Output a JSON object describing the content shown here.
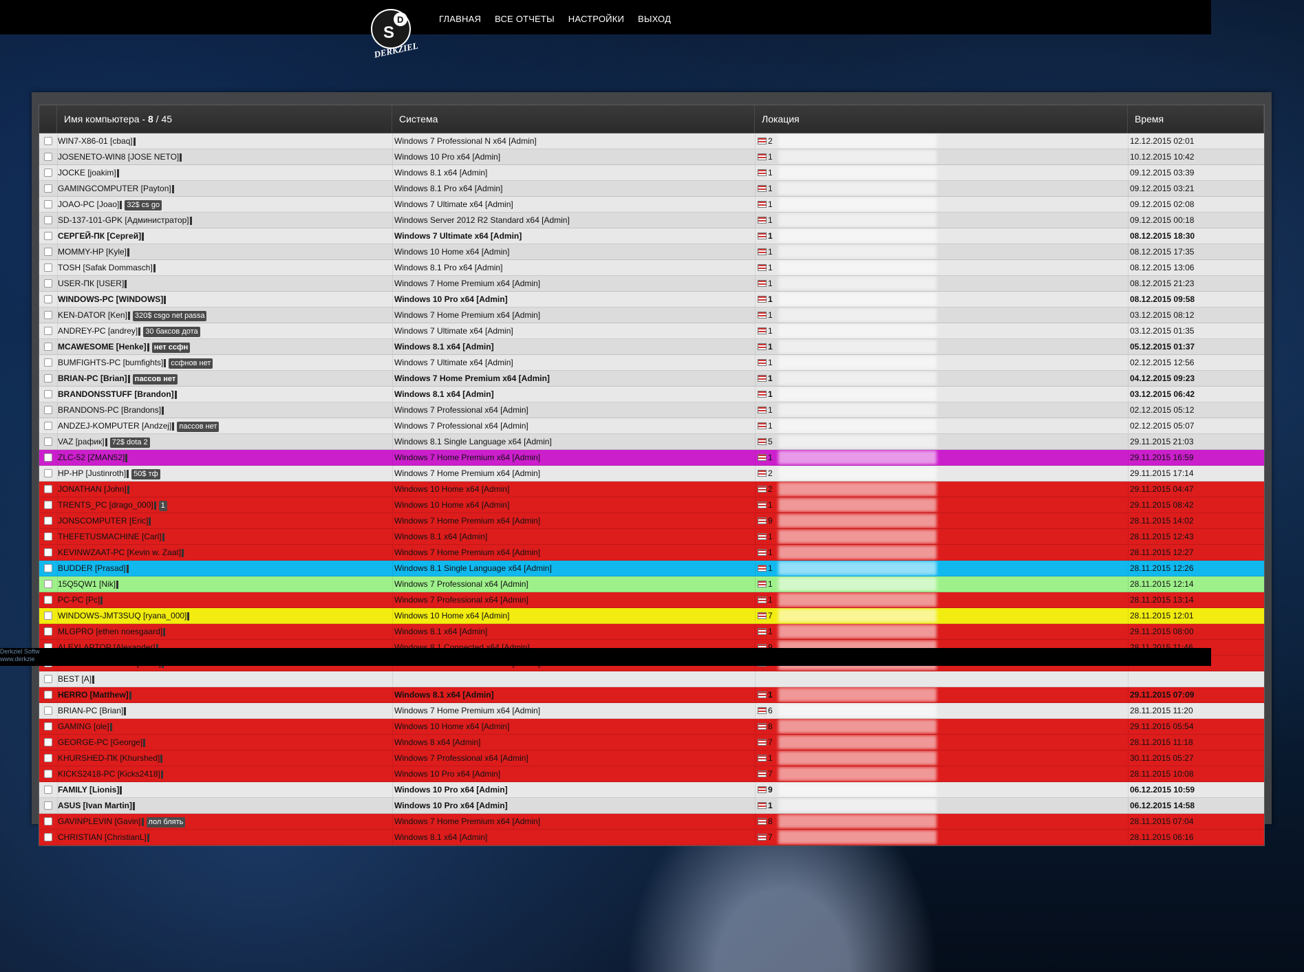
{
  "nav": {
    "items": [
      "ГЛАВНАЯ",
      "ВСЕ ОТЧЕТЫ",
      "НАСТРОЙКИ",
      "ВЫХОД"
    ]
  },
  "logo": {
    "text": "DERKZIEL SOFTWARE"
  },
  "footer": {
    "line1": "Derkziel Softw",
    "line2": "www.derkzie"
  },
  "table": {
    "headers": {
      "computer": "Имя компьютера - ",
      "count_current": "8",
      "count_total": " / 45",
      "system": "Система",
      "location": "Локация",
      "time": "Время"
    },
    "rows": [
      {
        "name": "WIN7-X86-01 [cbaq]",
        "tag": "",
        "system": "Windows 7 Professional N x64 [Admin]",
        "loc": "2",
        "time": "12.12.2015 02:01",
        "bg": "#e8e8e8",
        "bold": false
      },
      {
        "name": "JOSENETO-WIN8 [JOSE NETO]",
        "tag": "",
        "system": "Windows 10 Pro x64 [Admin]",
        "loc": "1",
        "time": "10.12.2015 10:42",
        "bg": "#dcdcdc",
        "bold": false
      },
      {
        "name": "JOCKE [joakim]",
        "tag": "",
        "system": "Windows 8.1 x64 [Admin]",
        "loc": "1",
        "time": "09.12.2015 03:39",
        "bg": "#e8e8e8",
        "bold": false
      },
      {
        "name": "GAMINGCOMPUTER [Payton]",
        "tag": "",
        "system": "Windows 8.1 Pro x64 [Admin]",
        "loc": "1",
        "time": "09.12.2015 03:21",
        "bg": "#dcdcdc",
        "bold": false
      },
      {
        "name": "JOAO-PC [Joao]",
        "tag": "32$ cs go",
        "system": "Windows 7 Ultimate x64 [Admin]",
        "loc": "1",
        "time": "09.12.2015 02:08",
        "bg": "#e8e8e8",
        "bold": false
      },
      {
        "name": "SD-137-101-GPK [Администратор]",
        "tag": "",
        "system": "Windows Server 2012 R2 Standard x64 [Admin]",
        "loc": "1",
        "time": "09.12.2015 00:18",
        "bg": "#dcdcdc",
        "bold": false
      },
      {
        "name": "СЕРГЕЙ-ПК [Сергей]",
        "tag": "",
        "system": "Windows 7 Ultimate x64 [Admin]",
        "loc": "1",
        "time": "08.12.2015 18:30",
        "bg": "#e8e8e8",
        "bold": true
      },
      {
        "name": "MOMMY-HP [Kyle]",
        "tag": "",
        "system": "Windows 10 Home x64 [Admin]",
        "loc": "1",
        "time": "08.12.2015 17:35",
        "bg": "#dcdcdc",
        "bold": false
      },
      {
        "name": "TOSH [Safak Dommasch]",
        "tag": "",
        "system": "Windows 8.1 Pro x64 [Admin]",
        "loc": "1",
        "time": "08.12.2015 13:06",
        "bg": "#e8e8e8",
        "bold": false
      },
      {
        "name": "USER-ПК [USER]",
        "tag": "",
        "system": "Windows 7 Home Premium x64 [Admin]",
        "loc": "1",
        "time": "08.12.2015 21:23",
        "bg": "#dcdcdc",
        "bold": false
      },
      {
        "name": "WINDOWS-PC [WINDOWS]",
        "tag": "",
        "system": "Windows 10 Pro x64 [Admin]",
        "loc": "1",
        "time": "08.12.2015 09:58",
        "bg": "#e8e8e8",
        "bold": true
      },
      {
        "name": "KEN-DATOR [Ken]",
        "tag": "320$ csgo net passa",
        "system": "Windows 7 Home Premium x64 [Admin]",
        "loc": "1",
        "time": "03.12.2015 08:12",
        "bg": "#dcdcdc",
        "bold": false
      },
      {
        "name": "ANDREY-PC [andrey]",
        "tag": "30 баксов дота",
        "system": "Windows 7 Ultimate x64 [Admin]",
        "loc": "1",
        "time": "03.12.2015 01:35",
        "bg": "#e8e8e8",
        "bold": false
      },
      {
        "name": "MCAWESOME [Henke]",
        "tag": "нет ссфн",
        "system": "Windows 8.1 x64 [Admin]",
        "loc": "1",
        "time": "05.12.2015 01:37",
        "bg": "#dcdcdc",
        "bold": true
      },
      {
        "name": "BUMFIGHTS-PC [bumfights]",
        "tag": "ссфнов нет",
        "system": "Windows 7 Ultimate x64 [Admin]",
        "loc": "1",
        "time": "02.12.2015 12:56",
        "bg": "#e8e8e8",
        "bold": false
      },
      {
        "name": "BRIAN-PC [Brian]",
        "tag": "пассов нет",
        "system": "Windows 7 Home Premium x64 [Admin]",
        "loc": "1",
        "time": "04.12.2015 09:23",
        "bg": "#dcdcdc",
        "bold": true
      },
      {
        "name": "BRANDONSSTUFF [Brandon]",
        "tag": "",
        "system": "Windows 8.1 x64 [Admin]",
        "loc": "1",
        "time": "03.12.2015 06:42",
        "bg": "#e8e8e8",
        "bold": true
      },
      {
        "name": "BRANDONS-PC [Brandons]",
        "tag": "",
        "system": "Windows 7 Professional x64 [Admin]",
        "loc": "1",
        "time": "02.12.2015 05:12",
        "bg": "#dcdcdc",
        "bold": false
      },
      {
        "name": "ANDZEJ-KOMPUTER [Andzej]",
        "tag": "пассов нет",
        "system": "Windows 7 Professional x64 [Admin]",
        "loc": "1",
        "time": "02.12.2015 05:07",
        "bg": "#e8e8e8",
        "bold": false
      },
      {
        "name": "VAZ [рафик]",
        "tag": "72$ dota 2",
        "system": "Windows 8.1 Single Language x64 [Admin]",
        "loc": "5",
        "time": "29.11.2015 21:03",
        "bg": "#dcdcdc",
        "bold": false
      },
      {
        "name": "ZLC-52 [ZMAN52]",
        "tag": "",
        "system": "Windows 7 Home Premium x64 [Admin]",
        "loc": "1",
        "time": "29.11.2015 16:59",
        "bg": "#cc1fcc",
        "bold": false
      },
      {
        "name": "HP-HP [Justinroth]",
        "tag": "50$ тф",
        "system": "Windows 7 Home Premium x64 [Admin]",
        "loc": "2",
        "time": "29.11.2015 17:14",
        "bg": "#e8e8e8",
        "bold": false
      },
      {
        "name": "JONATHAN [John]",
        "tag": "",
        "system": "Windows 10 Home x64 [Admin]",
        "loc": "2",
        "time": "29.11.2015 04:47",
        "bg": "#dd1c1c",
        "bold": false
      },
      {
        "name": "TRENTS_PC [drago_000]",
        "tag": "1",
        "system": "Windows 10 Home x64 [Admin]",
        "loc": "1",
        "time": "29.11.2015 08:42",
        "bg": "#dd1c1c",
        "bold": false
      },
      {
        "name": "JONSCOMPUTER [Eric]",
        "tag": "",
        "system": "Windows 7 Home Premium x64 [Admin]",
        "loc": "9",
        "time": "28.11.2015 14:02",
        "bg": "#dd1c1c",
        "bold": false
      },
      {
        "name": "THEFETUSMACHINE [Carl]",
        "tag": "",
        "system": "Windows 8.1 x64 [Admin]",
        "loc": "1",
        "time": "28.11.2015 12:43",
        "bg": "#dd1c1c",
        "bold": false
      },
      {
        "name": "KEVINWZAAT-PC [Kevin w. Zaat]",
        "tag": "",
        "system": "Windows 7 Home Premium x64 [Admin]",
        "loc": "1",
        "time": "28.11.2015 12:27",
        "bg": "#dd1c1c",
        "bold": false
      },
      {
        "name": "BUDDER [Prasad]",
        "tag": "",
        "system": "Windows 8.1 Single Language x64 [Admin]",
        "loc": "1",
        "time": "28.11.2015 12:26",
        "bg": "#10b8ee",
        "bold": false
      },
      {
        "name": "15Q5QW1 [Nik]",
        "tag": "",
        "system": "Windows 7 Professional x64 [Admin]",
        "loc": "1",
        "time": "28.11.2015 12:14",
        "bg": "#9ef08a",
        "bold": false
      },
      {
        "name": "PC-PC [Pc]",
        "tag": "",
        "system": "Windows 7 Professional x64 [Admin]",
        "loc": "1",
        "time": "28.11.2015 13:14",
        "bg": "#dd1c1c",
        "bold": false
      },
      {
        "name": "WINDOWS-JMT3SUQ [ryana_000]",
        "tag": "",
        "system": "Windows 10 Home x64 [Admin]",
        "loc": "7",
        "time": "28.11.2015 12:01",
        "bg": "#f2ec10",
        "bold": false
      },
      {
        "name": "MLGPRO [ethen noesgaard]",
        "tag": "",
        "system": "Windows 8.1 x64 [Admin]",
        "loc": "1",
        "time": "29.11.2015 08:00",
        "bg": "#dd1c1c",
        "bold": false
      },
      {
        "name": "ALEXLAPTOP [Alexander]",
        "tag": "",
        "system": "Windows 8.1 Connected x64 [Admin]",
        "loc": "9",
        "time": "28.11.2015 11:46",
        "bg": "#dd1c1c",
        "bold": false
      },
      {
        "name": "NOAHSCOMPUTER [Noah]",
        "tag": "",
        "system": "Windows 7 Home Premium x64 [Admin]",
        "loc": "1",
        "time": "28.11.2015 11:39",
        "bg": "#dd1c1c",
        "bold": false
      },
      {
        "name": "BEST [A]",
        "tag": "",
        "system": "",
        "loc": "",
        "time": "",
        "bg": "#e8e8e8",
        "bold": false
      },
      {
        "name": "HERRO [Matthew]",
        "tag": "",
        "system": "Windows 8.1 x64 [Admin]",
        "loc": "1",
        "time": "29.11.2015 07:09",
        "bg": "#dd1c1c",
        "bold": true
      },
      {
        "name": "BRIAN-PC [Brian]",
        "tag": "",
        "system": "Windows 7 Home Premium x64 [Admin]",
        "loc": "6",
        "time": "28.11.2015 11:20",
        "bg": "#e8e8e8",
        "bold": false
      },
      {
        "name": "GAMING [ole]",
        "tag": "",
        "system": "Windows 10 Home x64 [Admin]",
        "loc": "8",
        "time": "29.11.2015 05:54",
        "bg": "#dd1c1c",
        "bold": false
      },
      {
        "name": "GEORGE-PC [George]",
        "tag": "",
        "system": "Windows 8 x64 [Admin]",
        "loc": "7",
        "time": "28.11.2015 11:18",
        "bg": "#dd1c1c",
        "bold": false
      },
      {
        "name": "KHURSHED-ПК [Khurshed]",
        "tag": "",
        "system": "Windows 7 Professional x64 [Admin]",
        "loc": "1",
        "time": "30.11.2015 05:27",
        "bg": "#dd1c1c",
        "bold": false
      },
      {
        "name": "KICKS2418-PC [Kicks2418]",
        "tag": "",
        "system": "Windows 10 Pro x64 [Admin]",
        "loc": "7",
        "time": "28.11.2015 10:08",
        "bg": "#dd1c1c",
        "bold": false
      },
      {
        "name": "FAMILY [Lionis]",
        "tag": "",
        "system": "Windows 10 Pro x64 [Admin]",
        "loc": "9",
        "time": "06.12.2015 10:59",
        "bg": "#e8e8e8",
        "bold": true
      },
      {
        "name": "ASUS [Ivan Martin]",
        "tag": "",
        "system": "Windows 10 Pro x64 [Admin]",
        "loc": "1",
        "time": "06.12.2015 14:58",
        "bg": "#dcdcdc",
        "bold": true
      },
      {
        "name": "GAVINPLEVIN [Gavin]",
        "tag": "лол блять",
        "system": "Windows 7 Home Premium x64 [Admin]",
        "loc": "8",
        "time": "28.11.2015 07:04",
        "bg": "#dd1c1c",
        "bold": false
      },
      {
        "name": "CHRISTIAN [ChristianL]",
        "tag": "",
        "system": "Windows 8.1 x64 [Admin]",
        "loc": "7",
        "time": "28.11.2015 06:16",
        "bg": "#dd1c1c",
        "bold": false
      }
    ]
  }
}
